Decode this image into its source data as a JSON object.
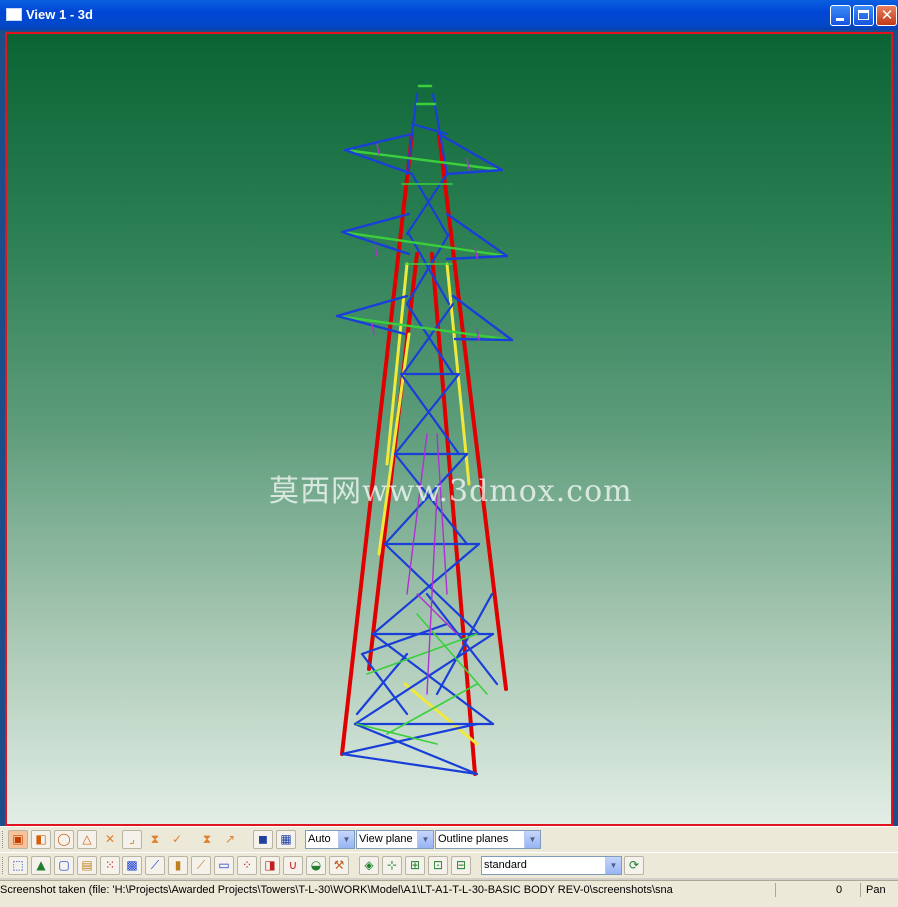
{
  "window": {
    "title": "View 1 - 3d",
    "buttons": [
      "minimize",
      "maximize",
      "close"
    ]
  },
  "viewport": {
    "watermark": "莫西网www.3dmox.com",
    "background_top": "#0a6434",
    "background_bottom": "#e2eee6",
    "border_color": "#e0131e",
    "model": "transmission tower wireframe",
    "member_colors": [
      "#e00000",
      "#1a3fd8",
      "#3ccf3c",
      "#f0e83a",
      "#b030d0"
    ]
  },
  "toolbar1": {
    "icons": [
      "ortho-icon",
      "select-icon",
      "circle-icon",
      "triangle-icon",
      "delete-icon",
      "dimension-icon",
      "hourglass-icon",
      "check-icon",
      "hourglass2-icon",
      "arrow-icon",
      "render-icon",
      "grid-icon"
    ],
    "auto_value": "Auto",
    "view_plane_value": "View plane",
    "outline_planes_value": "Outline planes"
  },
  "toolbar2": {
    "icons": [
      "select-all-icon",
      "part-icon",
      "bolt-icon",
      "weld-icon",
      "grid-points-icon",
      "snap-icon",
      "snap2-icon",
      "line-icon",
      "midpoint-icon",
      "perp-icon",
      "dots-icon",
      "component-icon",
      "magnet-icon",
      "plane-icon",
      "custom-icon",
      "snap-point-icon",
      "snap-end-icon",
      "snap-center-icon",
      "snap-node-icon",
      "snap-line-icon",
      "refresh-icon"
    ],
    "standard_value": "standard"
  },
  "status": {
    "message": "Screenshot taken (file: 'H:\\Projects\\Awarded Projects\\Towers\\T-L-30\\WORK\\Model\\A1\\LT-A1-T-L-30-BASIC BODY REV-0\\screenshots\\sna",
    "count": "0",
    "mode": "Pan"
  }
}
